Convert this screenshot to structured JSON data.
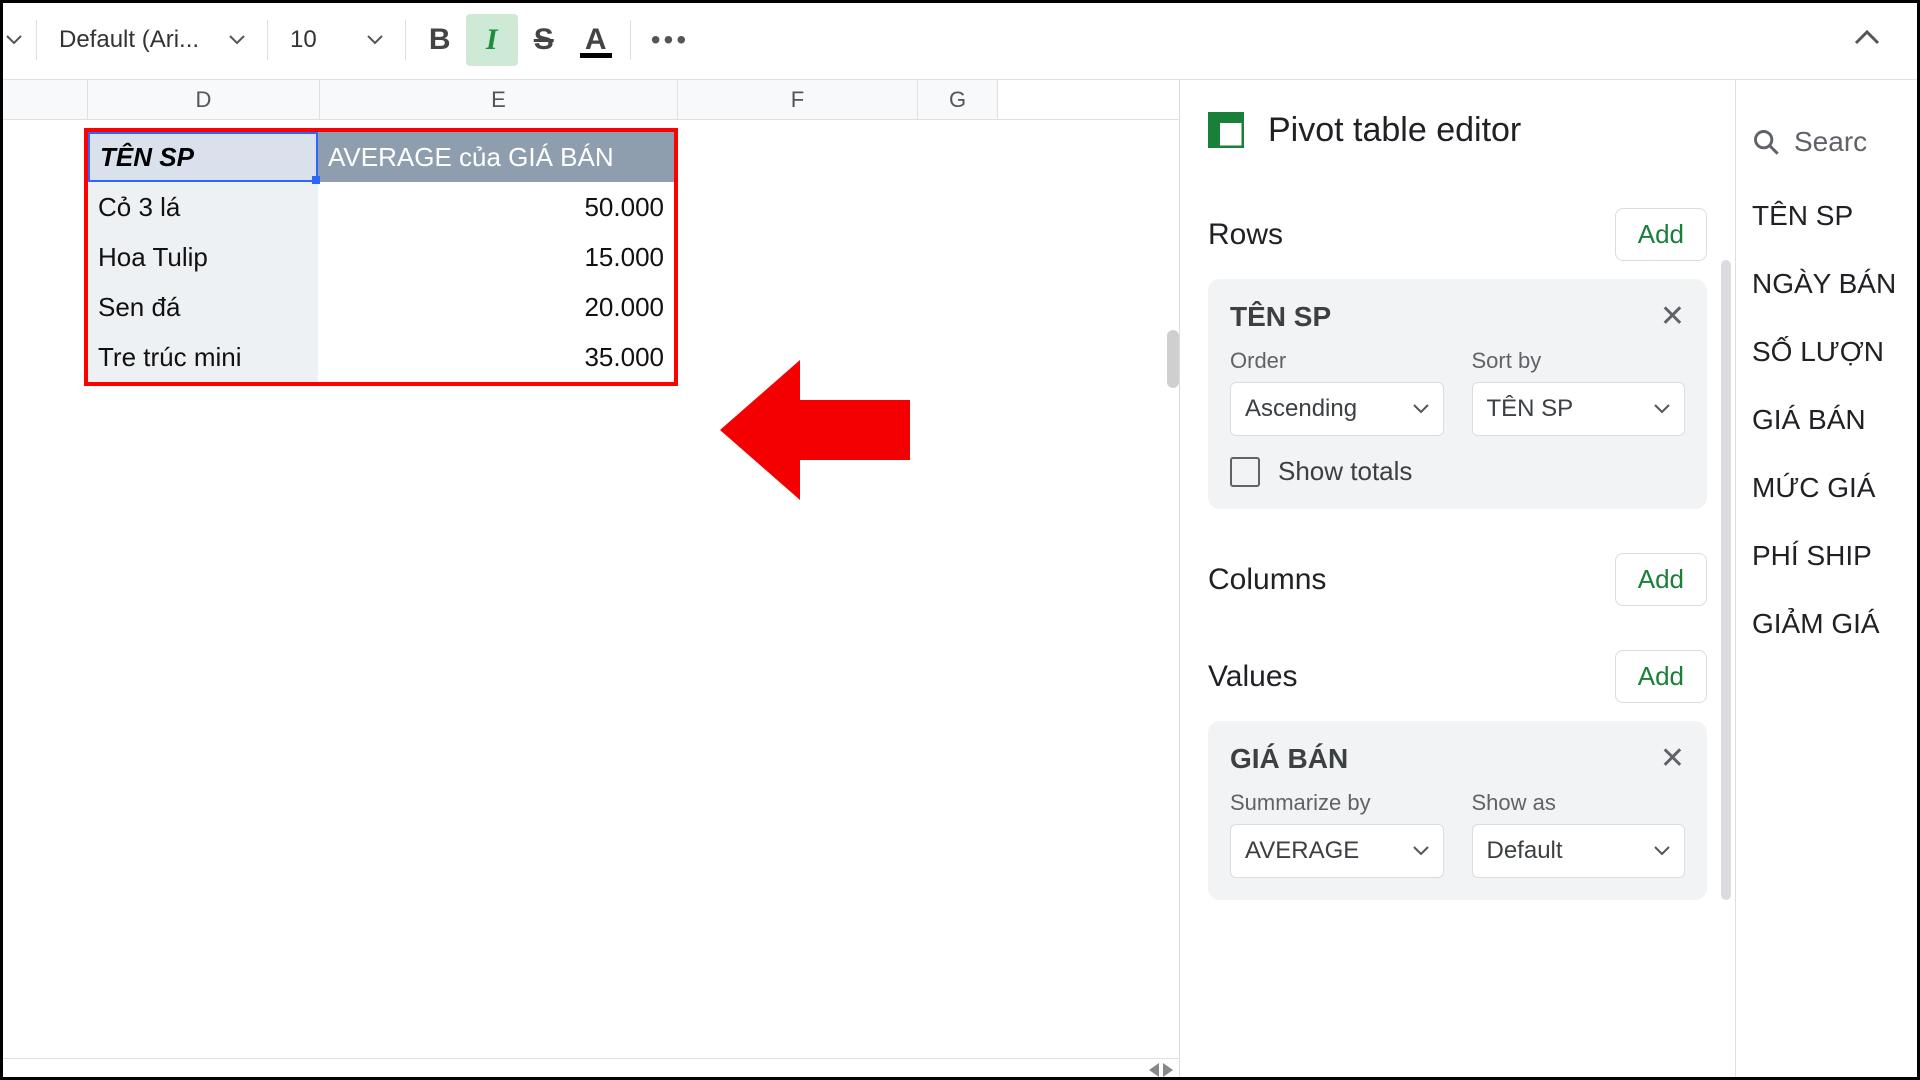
{
  "toolbar": {
    "font_name": "Default (Ari...",
    "font_size": "10",
    "bold": "B",
    "italic": "I",
    "strike": "S",
    "textcolor": "A",
    "more": "..."
  },
  "columns": {
    "D": "D",
    "E": "E",
    "F": "F",
    "G": "G"
  },
  "pivot": {
    "header_col1": "TÊN SP",
    "header_col2": "AVERAGE của GIÁ BÁN",
    "rows": [
      {
        "name": "Cỏ 3 lá",
        "value": "50.000"
      },
      {
        "name": "Hoa Tulip",
        "value": "15.000"
      },
      {
        "name": "Sen đá",
        "value": "20.000"
      },
      {
        "name": "Tre trúc mini",
        "value": "35.000"
      }
    ]
  },
  "editor": {
    "title": "Pivot table editor",
    "rows_label": "Rows",
    "columns_label": "Columns",
    "values_label": "Values",
    "add_label": "Add",
    "row_card": {
      "title": "TÊN SP",
      "order_label": "Order",
      "order_value": "Ascending",
      "sortby_label": "Sort by",
      "sortby_value": "TÊN SP",
      "show_totals": "Show totals"
    },
    "value_card": {
      "title": "GIÁ BÁN",
      "summarize_label": "Summarize by",
      "summarize_value": "AVERAGE",
      "showas_label": "Show as",
      "showas_value": "Default"
    },
    "search_placeholder": "Searc",
    "fields": [
      "TÊN SP",
      "NGÀY BÁN",
      "SỐ LƯỢN",
      "GIÁ BÁN",
      "MỨC GIÁ",
      "PHÍ SHIP",
      "GIẢM GIÁ"
    ]
  }
}
